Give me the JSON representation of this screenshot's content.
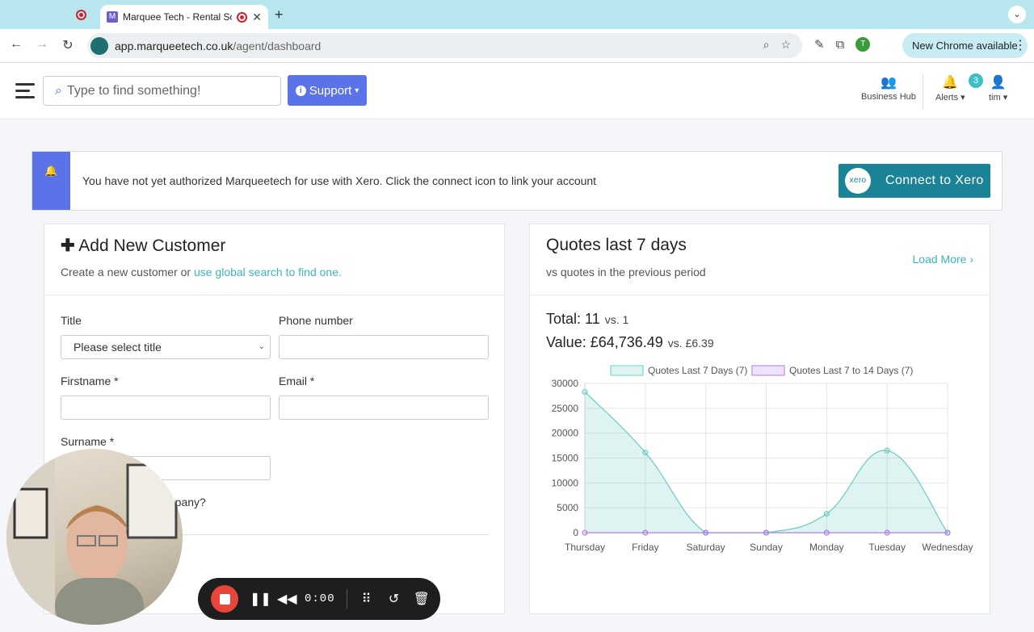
{
  "browser": {
    "tab_title": "Marquee Tech - Rental So",
    "url_host": "app.marqueetech.co.uk",
    "url_path": "/agent/dashboard",
    "profile_initial": "T",
    "update_label": "New Chrome available"
  },
  "header": {
    "search_placeholder": "Type to find something!",
    "support_label": "Support",
    "business_hub_label": "Business Hub",
    "alerts_label": "Alerts",
    "alerts_count": "3",
    "user_label": "tim"
  },
  "xero": {
    "message": "You have not yet authorized Marqueetech for use with Xero. Click the connect icon to link your account",
    "logo_text": "xero",
    "connect_label": "Connect to Xero"
  },
  "add_customer": {
    "title": "Add New Customer",
    "subtitle_prefix": "Create a new customer or ",
    "subtitle_link": "use global search to find one.",
    "title_label": "Title",
    "title_select_value": "Please select title",
    "phone_label": "Phone number",
    "firstname_label": "Firstname *",
    "email_label": "Email *",
    "surname_label": "Surname *",
    "company_label_partial": "mpany?"
  },
  "quotes": {
    "title": "Quotes last 7 days",
    "subtitle": "vs quotes in the previous period",
    "load_more": "Load More",
    "total_label": "Total: 11",
    "total_prev": "vs. 1",
    "value_label": "Value: £64,736.49",
    "value_prev": "vs. £6.39"
  },
  "recorder": {
    "time": "0:00"
  },
  "colors": {
    "accent": "#5b73e8",
    "xero": "#1b8396",
    "link": "#3cb5b9",
    "series_current": "#6fcfc4",
    "series_previous": "#b07ee8"
  },
  "chart_data": {
    "type": "line",
    "categories": [
      "Thursday",
      "Friday",
      "Saturday",
      "Sunday",
      "Monday",
      "Tuesday",
      "Wednesday"
    ],
    "series": [
      {
        "name": "Quotes Last 7 Days (7)",
        "values": [
          28300,
          16100,
          0,
          0,
          3800,
          16500,
          0
        ],
        "fill": true
      },
      {
        "name": "Quotes Last 7 to 14 Days (7)",
        "values": [
          0,
          0,
          0,
          0,
          0,
          0,
          0
        ],
        "fill": true
      }
    ],
    "ylim": [
      0,
      30000
    ],
    "yticks": [
      "0",
      "5000",
      "10000",
      "15000",
      "20000",
      "25000",
      "30000"
    ],
    "grid": true,
    "legend": "top"
  }
}
